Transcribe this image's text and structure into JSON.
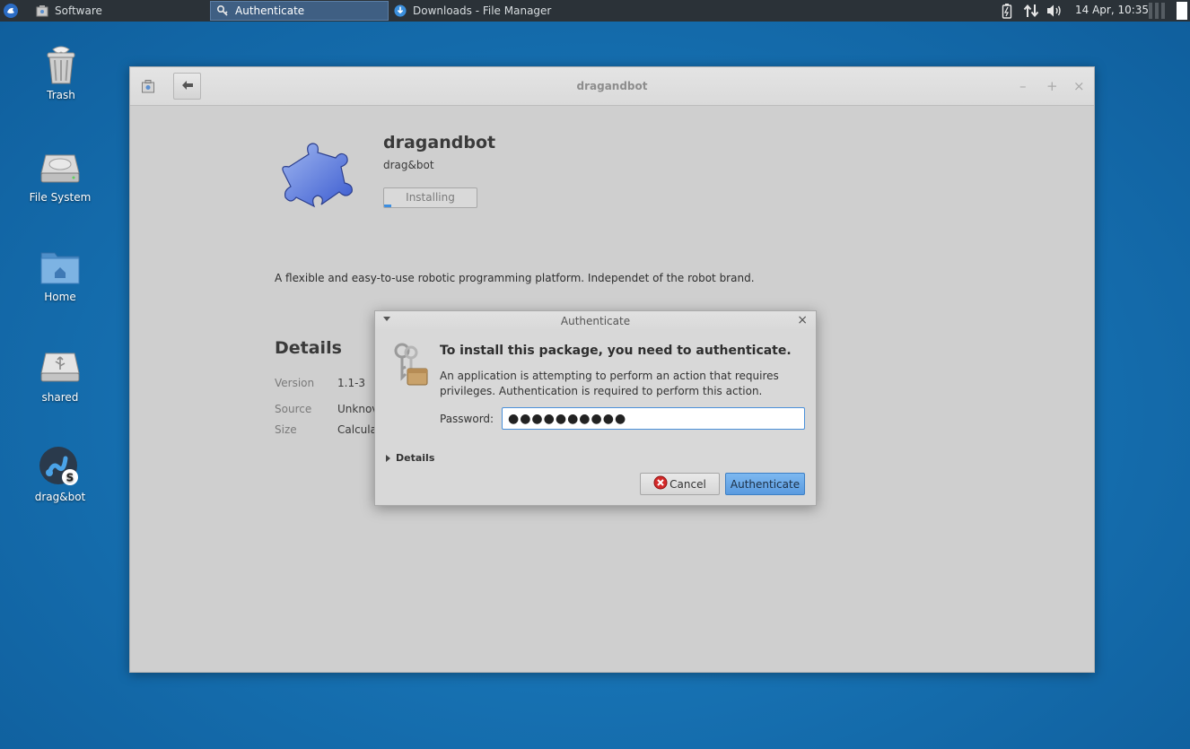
{
  "panel": {
    "tasks": [
      {
        "label": "Software",
        "icon": "software-center-icon",
        "active": false
      },
      {
        "label": "Authenticate",
        "icon": "keys-icon",
        "active": true
      },
      {
        "label": "Downloads - File Manager",
        "icon": "download-icon",
        "active": false
      }
    ],
    "clock": "14 Apr, 10:35"
  },
  "desktop": {
    "icons": [
      {
        "label": "Trash",
        "icon": "trash-icon"
      },
      {
        "label": "File System",
        "icon": "hard-drive-icon"
      },
      {
        "label": "Home",
        "icon": "home-folder-icon"
      },
      {
        "label": "shared",
        "icon": "usb-drive-icon"
      },
      {
        "label": "drag&bot",
        "icon": "dragandbot-app-icon"
      }
    ]
  },
  "window": {
    "title": "dragandbot",
    "app": {
      "name": "dragandbot",
      "subtitle": "drag&bot",
      "install_label": "Installing",
      "install_progress": 0.08,
      "description": "A flexible and easy-to-use robotic programming platform. Independet of the robot brand."
    },
    "details": {
      "heading": "Details",
      "rows": [
        {
          "key": "Version",
          "value": "1.1-3"
        },
        {
          "key": "Source",
          "value": "Unknov"
        },
        {
          "key": "Size",
          "value": "Calcula"
        }
      ]
    }
  },
  "dialog": {
    "title": "Authenticate",
    "heading": "To install this package, you need to authenticate.",
    "body": "An application is attempting to perform an action that requires privileges. Authentication is required to perform this action.",
    "password_label": "Password:",
    "password_value": "●●●●●●●●●●",
    "details_label": "Details",
    "cancel_label": "Cancel",
    "authenticate_label": "Authenticate"
  },
  "colors": {
    "desktop": "#1772b3",
    "panel": "#2b3238",
    "accent": "#5a9be0"
  }
}
